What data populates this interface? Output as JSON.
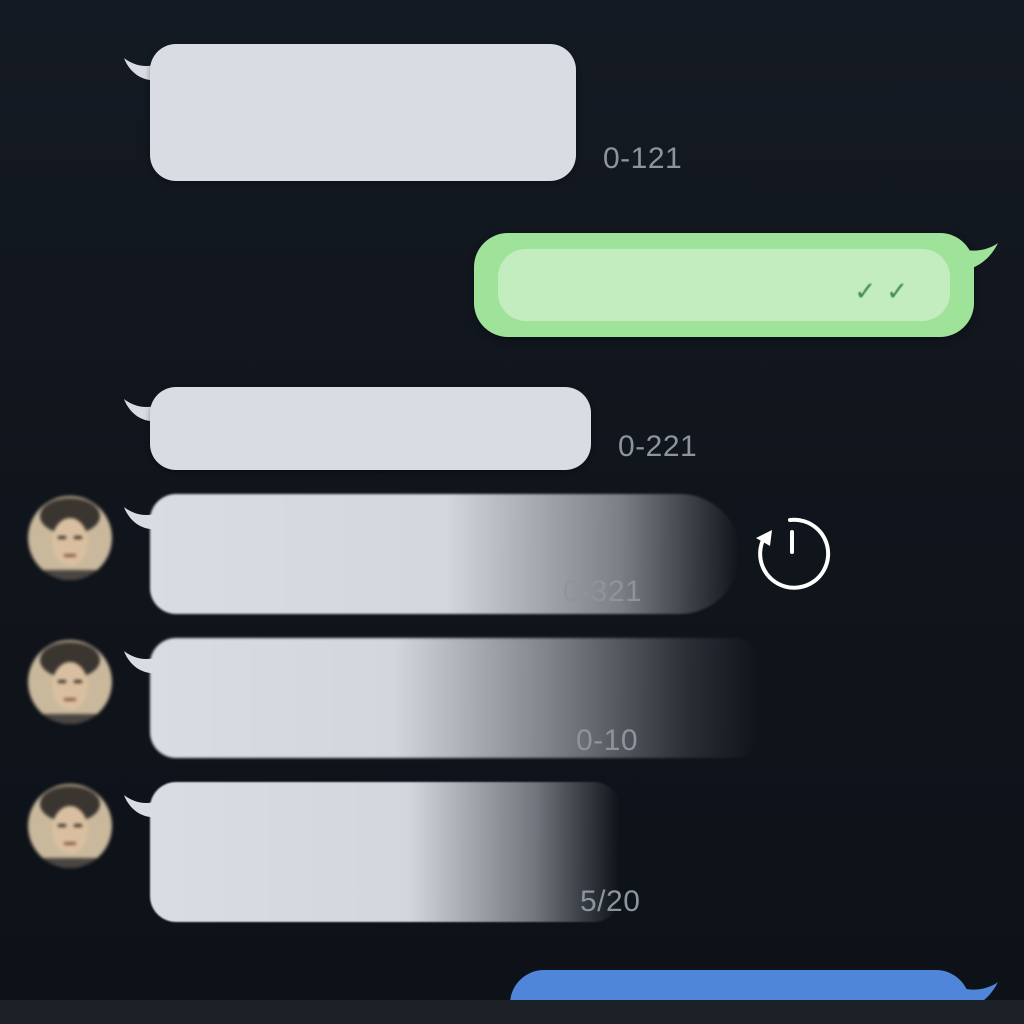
{
  "messages": [
    {
      "id": "m1",
      "direction": "incoming",
      "timestamp": "0-121"
    },
    {
      "id": "m2",
      "direction": "outgoing",
      "status_icon": "double-check-icon"
    },
    {
      "id": "m3",
      "direction": "incoming",
      "timestamp": "0-221"
    },
    {
      "id": "m4",
      "direction": "incoming",
      "timestamp": "0-321",
      "has_avatar": true,
      "state": "swiping"
    },
    {
      "id": "m5",
      "direction": "incoming",
      "timestamp": "0-10",
      "has_avatar": true,
      "state": "swiping"
    },
    {
      "id": "m6",
      "direction": "incoming",
      "timestamp": "5/20",
      "has_avatar": true
    }
  ],
  "icons": {
    "swipe_action": "timer-undo-icon",
    "read_receipt": "double-check-icon"
  },
  "colors": {
    "background": "#12161d",
    "incoming_bubble": "#d9dde3",
    "outgoing_bubble": "#9fe29a",
    "outgoing_inner": "#c4edbf",
    "partial_bubble": "#4f86d9",
    "timestamp": "#8e949c"
  }
}
